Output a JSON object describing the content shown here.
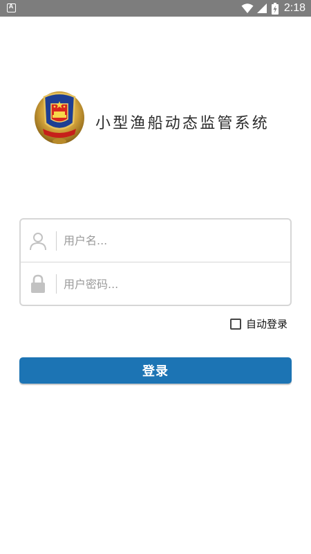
{
  "status_bar": {
    "left_icon_letter": "A",
    "time": "2:18",
    "icons": [
      "wifi-icon",
      "signal-icon",
      "battery-charging-icon"
    ]
  },
  "app": {
    "title": "小型渔船动态监管系统",
    "emblem": "police-emblem"
  },
  "login_form": {
    "username": {
      "value": "",
      "placeholder": "用户名...",
      "icon": "user-icon"
    },
    "password": {
      "value": "",
      "placeholder": "用户密码...",
      "icon": "lock-icon"
    },
    "auto_login": {
      "label": "自动登录",
      "checked": false
    },
    "submit_label": "登录"
  },
  "colors": {
    "status_bar": "#7d7d7d",
    "primary_button": "#1c74b4",
    "border": "#d6d6d6",
    "icon_gray": "#c2c2c2"
  }
}
